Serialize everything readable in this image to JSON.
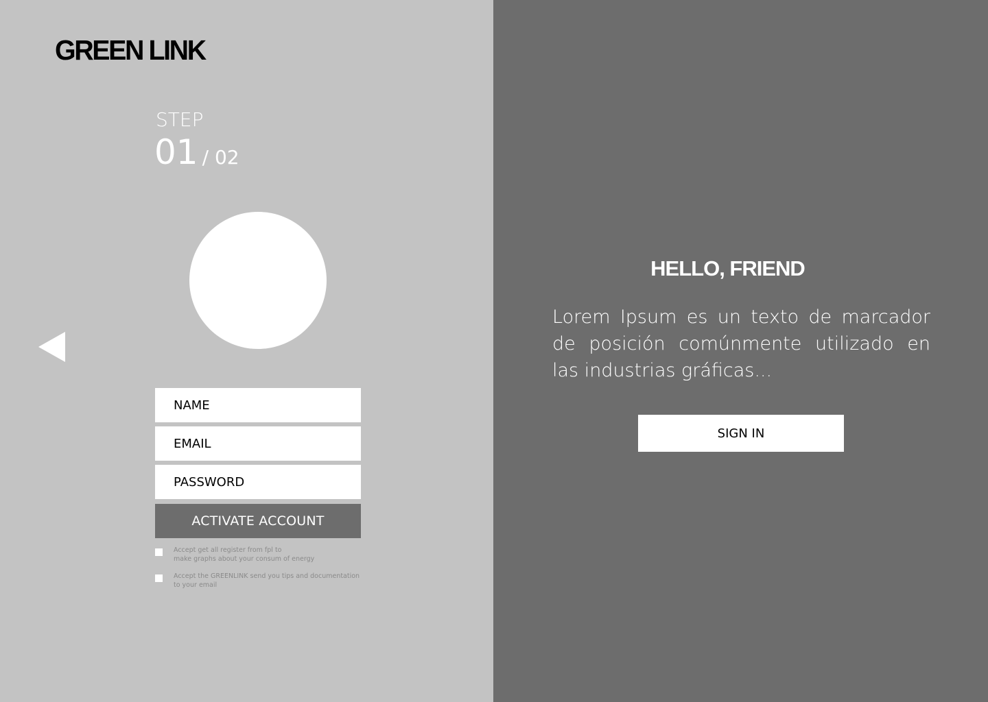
{
  "brand": {
    "logo_text": "GREEN LINK"
  },
  "step": {
    "label": "STEP",
    "current": "01",
    "total": "/ 02"
  },
  "form": {
    "name_placeholder": "NAME",
    "email_placeholder": "EMAIL",
    "password_placeholder": "PASSWORD",
    "activate_label": "ACTIVATE ACCOUNT"
  },
  "consents": [
    {
      "line1": "Accept get all register from fpl to",
      "line2": "make graphs about your consum of energy"
    },
    {
      "line1": "Accept the GREENLINK send you tips and documentation",
      "line2": "to your email"
    }
  ],
  "welcome": {
    "title": "HELLO, FRIEND",
    "text": "Lorem Ipsum es un texto de marcador de posición comúnmente utilizado en las industrias gráficas...",
    "sign_in_label": "SIGN IN"
  },
  "colors": {
    "left_panel": "#c3c3c3",
    "right_panel": "#6d6d6d",
    "surface": "#ffffff",
    "text_dark": "#000000",
    "muted_text": "#8a8a8a"
  },
  "icons": {
    "back": "back-arrow-icon"
  }
}
